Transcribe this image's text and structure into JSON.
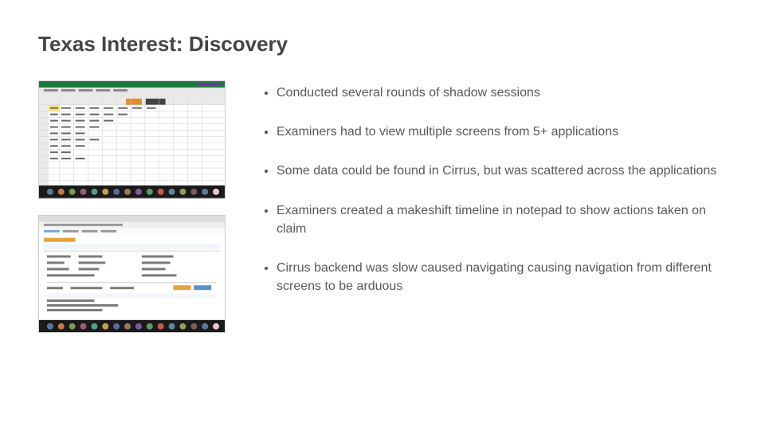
{
  "title": "Texas Interest: Discovery",
  "bullets": [
    "Conducted several rounds of shadow sessions",
    "Examiners had to view multiple screens from 5+ applications",
    "Some data could be found in Cirrus, but was scattered across the applications",
    "Examiners created a makeshift timeline in notepad to show actions taken on claim",
    "Cirrus backend was slow caused navigating causing navigation from different screens to be arduous"
  ],
  "thumbnails": [
    {
      "name": "excel-spreadsheet-screenshot"
    },
    {
      "name": "cirrus-webapp-screenshot"
    }
  ]
}
